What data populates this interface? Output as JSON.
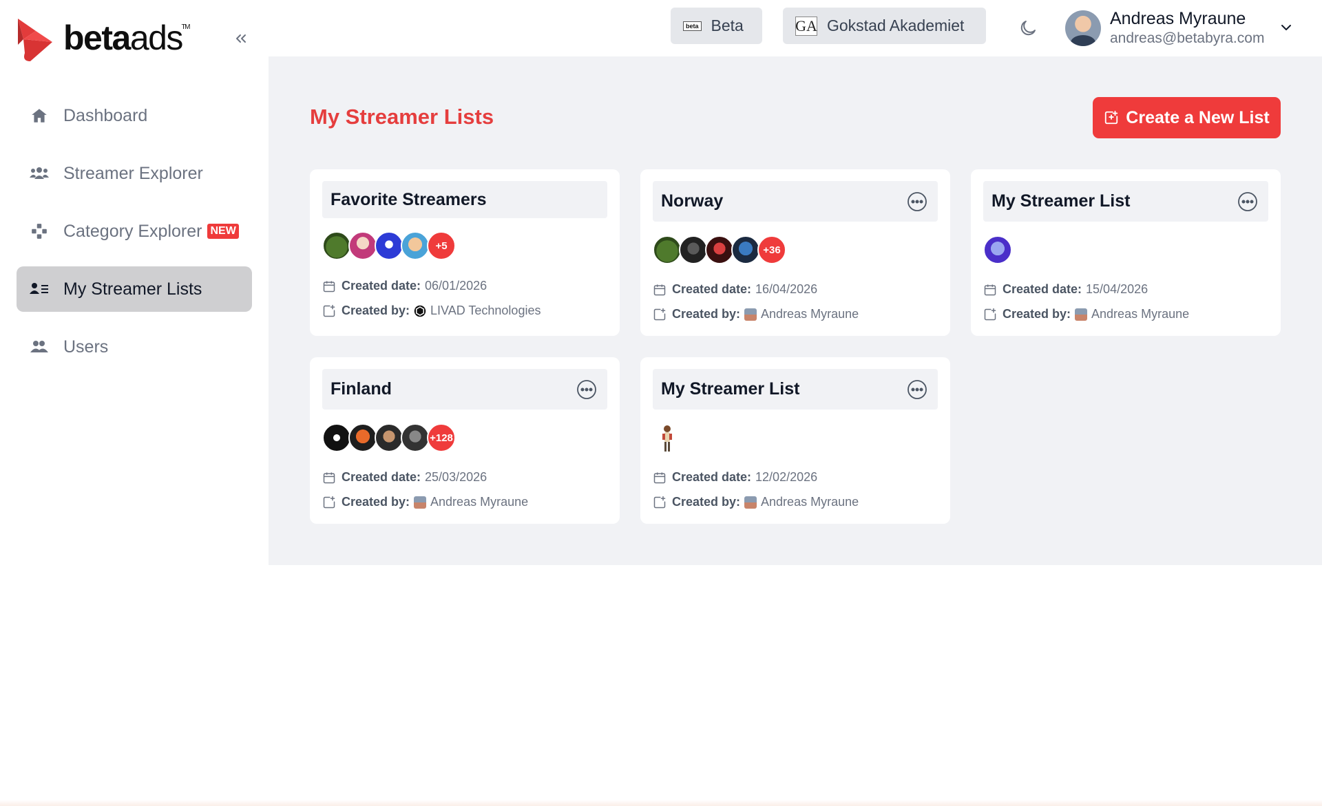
{
  "brand": {
    "name_bold": "beta",
    "name_light": "ads",
    "trademark": "TM"
  },
  "sidebar": {
    "items": [
      {
        "label": "Dashboard",
        "icon": "home-icon",
        "active": false
      },
      {
        "label": "Streamer Explorer",
        "icon": "users-icon",
        "active": false
      },
      {
        "label": "Category Explorer",
        "icon": "gamepad-icon",
        "active": false,
        "badge": "NEW"
      },
      {
        "label": "My Streamer Lists",
        "icon": "user-list-icon",
        "active": true
      },
      {
        "label": "Users",
        "icon": "group-icon",
        "active": false
      }
    ]
  },
  "topbar": {
    "org_beta": {
      "label": "Beta",
      "logo": "beta"
    },
    "org_ga": {
      "label": "Gokstad Akademiet",
      "logo": "GA"
    },
    "theme_icon": "moon-icon",
    "user": {
      "name": "Andreas Myraune",
      "email": "andreas@betabyra.com"
    }
  },
  "main": {
    "title": "My Streamer Lists",
    "create_label": "Create a New List",
    "created_date_label": "Created date:",
    "created_by_label": "Created by:",
    "cards": [
      {
        "title": "Favorite Streamers",
        "extra_count": "+5",
        "created_date": "06/01/2026",
        "created_by": "LIVAD Technologies",
        "has_menu": false
      },
      {
        "title": "Norway",
        "extra_count": "+36",
        "created_date": "16/04/2026",
        "created_by": "Andreas Myraune",
        "has_menu": true
      },
      {
        "title": "My Streamer List",
        "extra_count": "",
        "created_date": "15/04/2026",
        "created_by": "Andreas Myraune",
        "has_menu": true
      },
      {
        "title": "Finland",
        "extra_count": "+128",
        "created_date": "25/03/2026",
        "created_by": "Andreas Myraune",
        "has_menu": true
      },
      {
        "title": "My Streamer List",
        "extra_count": "",
        "created_date": "12/02/2026",
        "created_by": "Andreas Myraune",
        "has_menu": true
      }
    ]
  },
  "colors": {
    "accent": "#ef3b3b",
    "page_bg": "#f1f2f5",
    "active_nav": "#cfcfd1"
  }
}
